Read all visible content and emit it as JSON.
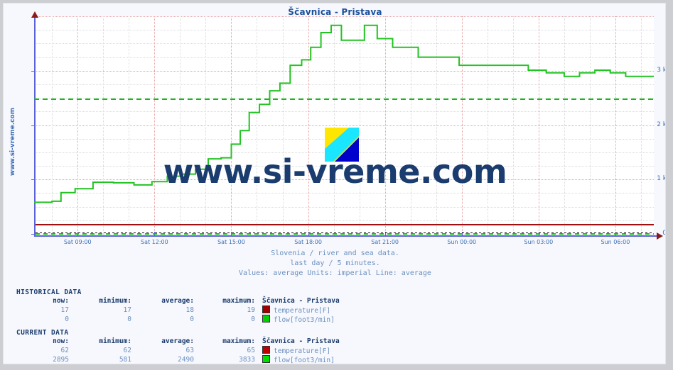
{
  "title": "Ščavnica - Pristava",
  "vertical_site_text": "www.si-vreme.com",
  "watermark": "www.si-vreme.com",
  "logo_name": "si-vreme-logo",
  "subtitle": {
    "line1": "Slovenia / river and sea data.",
    "line2": "last day / 5 minutes.",
    "line3": "Values: average  Units: imperial  Line: average"
  },
  "colors": {
    "title": "#1b4f9c",
    "flow_line": "#22c322",
    "temperature_line": "#9e1010",
    "average_line": "#11bb11",
    "axis": "#5b63d6",
    "grid_minor": "#d9dadd",
    "grid_major": "#e8a0a0",
    "watermark": "#1b3c6e",
    "text_blue": "#6b8fbf",
    "heading": "#1b3c6e",
    "plot_bg": "#ffffff",
    "page_bg": "#f6f8fd"
  },
  "chart_data": {
    "type": "line",
    "title": "Ščavnica - Pristava",
    "xlabel": "",
    "ylabel": "",
    "grid": true,
    "legend_position": "below-table",
    "ylim": [
      0,
      4000
    ],
    "yticks": [
      "0",
      "1 k",
      "2 k",
      "3 k"
    ],
    "ytick_values": [
      0,
      1000,
      2000,
      3000
    ],
    "xticks": [
      "Sat 09:00",
      "Sat 12:00",
      "Sat 15:00",
      "Sat 18:00",
      "Sat 21:00",
      "Sun 00:00",
      "Sun 03:00",
      "Sun 06:00"
    ],
    "xtick_values": [
      9,
      12,
      15,
      18,
      21,
      24,
      27,
      30
    ],
    "xlim": [
      7.3,
      31.5
    ],
    "annotations": {
      "average_flow_line": 2490,
      "temperature_flat_line": 62
    },
    "series": [
      {
        "name": "flow[foot3/min]",
        "color": "#22c322",
        "unit": "foot3/min",
        "x": [
          7.3,
          8.0,
          8.35,
          8.9,
          9.6,
          10.4,
          11.2,
          11.9,
          12.5,
          13.0,
          13.6,
          14.1,
          14.6,
          15.0,
          15.35,
          15.7,
          16.1,
          16.5,
          16.9,
          17.3,
          17.75,
          18.1,
          18.5,
          18.9,
          19.3,
          19.75,
          20.2,
          20.7,
          21.3,
          21.8,
          22.3,
          22.8,
          23.3,
          23.9,
          24.6,
          25.2,
          25.9,
          26.6,
          27.3,
          28.0,
          28.6,
          29.2,
          29.8,
          30.4,
          31.5
        ],
        "y": [
          581,
          600,
          760,
          830,
          950,
          940,
          900,
          960,
          1060,
          1100,
          1190,
          1380,
          1400,
          1650,
          1900,
          2230,
          2380,
          2630,
          2770,
          3100,
          3200,
          3430,
          3700,
          3833,
          3560,
          3560,
          3833,
          3590,
          3430,
          3430,
          3250,
          3250,
          3250,
          3100,
          3100,
          3100,
          3100,
          3010,
          2960,
          2895,
          2960,
          3010,
          2960,
          2895,
          2895
        ]
      },
      {
        "name": "temperature[F]",
        "color": "#9e1010",
        "unit": "F",
        "constant_value": 62
      }
    ]
  },
  "tables": [
    {
      "id": "historical",
      "title": "HISTORICAL DATA",
      "headers": [
        "now:",
        "minimum:",
        "average:",
        "maximum:",
        "Ščavnica - Pristava"
      ],
      "rows": [
        {
          "now": "17",
          "minimum": "17",
          "average": "18",
          "maximum": "19",
          "color": "#a00000",
          "name": "temperature[F]"
        },
        {
          "now": "0",
          "minimum": "0",
          "average": "0",
          "maximum": "0",
          "color": "#00d000",
          "name": "flow[foot3/min]"
        }
      ]
    },
    {
      "id": "current",
      "title": "CURRENT DATA",
      "headers": [
        "now:",
        "minimum:",
        "average:",
        "maximum:",
        "Ščavnica - Pristava"
      ],
      "rows": [
        {
          "now": "62",
          "minimum": "62",
          "average": "63",
          "maximum": "65",
          "color": "#c00000",
          "name": "temperature[F]"
        },
        {
          "now": "2895",
          "minimum": "581",
          "average": "2490",
          "maximum": "3833",
          "color": "#00e000",
          "name": "flow[foot3/min]"
        }
      ]
    }
  ]
}
